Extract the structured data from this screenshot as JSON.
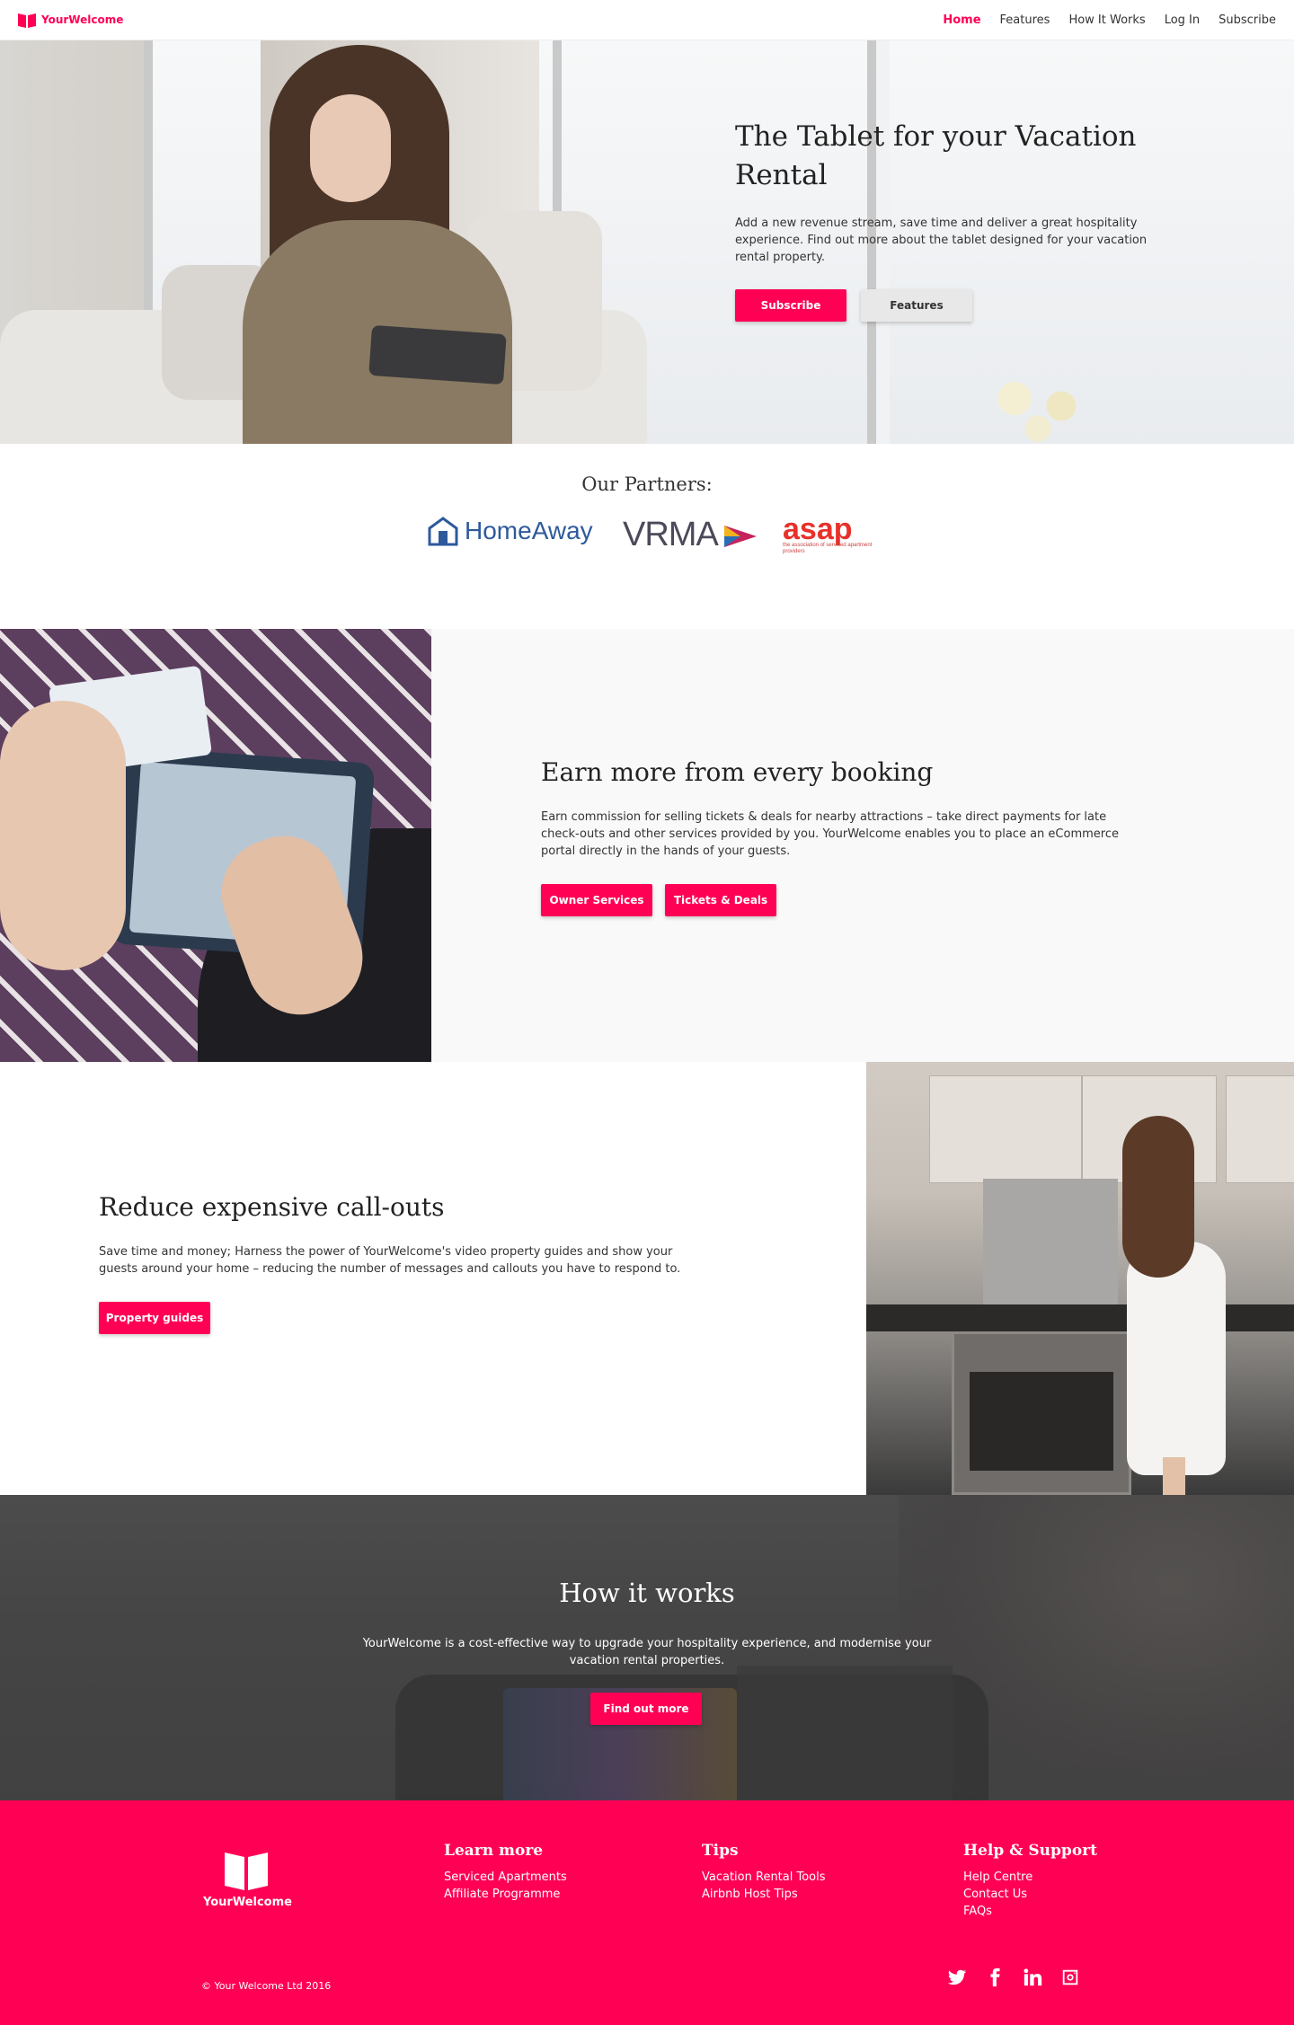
{
  "header": {
    "brand": "YourWelcome",
    "nav": [
      "Home",
      "Features",
      "How It Works",
      "Log In",
      "Subscribe"
    ]
  },
  "hero": {
    "title": "The Tablet for your Vacation Rental",
    "body": "Add a new revenue stream, save time and deliver a great hospitality experience. Find out more about the tablet designed for your vacation rental property.",
    "subscribe_label": "Subscribe",
    "features_label": "Features"
  },
  "partners": {
    "title": "Our Partners:",
    "logos": [
      "HomeAway",
      "VRMA",
      "asap",
      "the association of serviced apartment providers"
    ]
  },
  "earn": {
    "title": "Earn more from every booking",
    "body": "Earn commission for selling tickets & deals for nearby attractions – take direct payments for late check-outs and other services provided by you. YourWelcome enables you to place an eCommerce portal directly in the hands of your guests.",
    "btn1": "Owner Services",
    "btn2": "Tickets & Deals"
  },
  "reduce": {
    "title": "Reduce expensive call-outs",
    "body": "Save time and money; Harness the power of YourWelcome's video property guides and show your guests around your home – reducing the number of messages and callouts you have to respond to.",
    "btn": "Property guides"
  },
  "how": {
    "title": "How it works",
    "body": "YourWelcome is a cost-effective way to upgrade your hospitality experience, and modernise your vacation rental properties.",
    "btn": "Find out more"
  },
  "footer": {
    "brand": "YourWelcome",
    "learn_title": "Learn more",
    "learn_links": [
      "Serviced Apartments",
      "Affiliate Programme"
    ],
    "tips_title": "Tips",
    "tips_links": [
      "Vacation Rental Tools",
      "Airbnb Host Tips"
    ],
    "help_title": "Help & Support",
    "help_links": [
      "Help Centre",
      "Contact Us",
      "FAQs"
    ],
    "copyright": "© Your Welcome Ltd 2016",
    "social": [
      "twitter-icon",
      "facebook-icon",
      "linkedin-icon",
      "instagram-icon"
    ]
  },
  "colors": {
    "accent": "#ff0055",
    "button_grey": "#e8e8e8",
    "section_bg": "#f9f9f9"
  }
}
